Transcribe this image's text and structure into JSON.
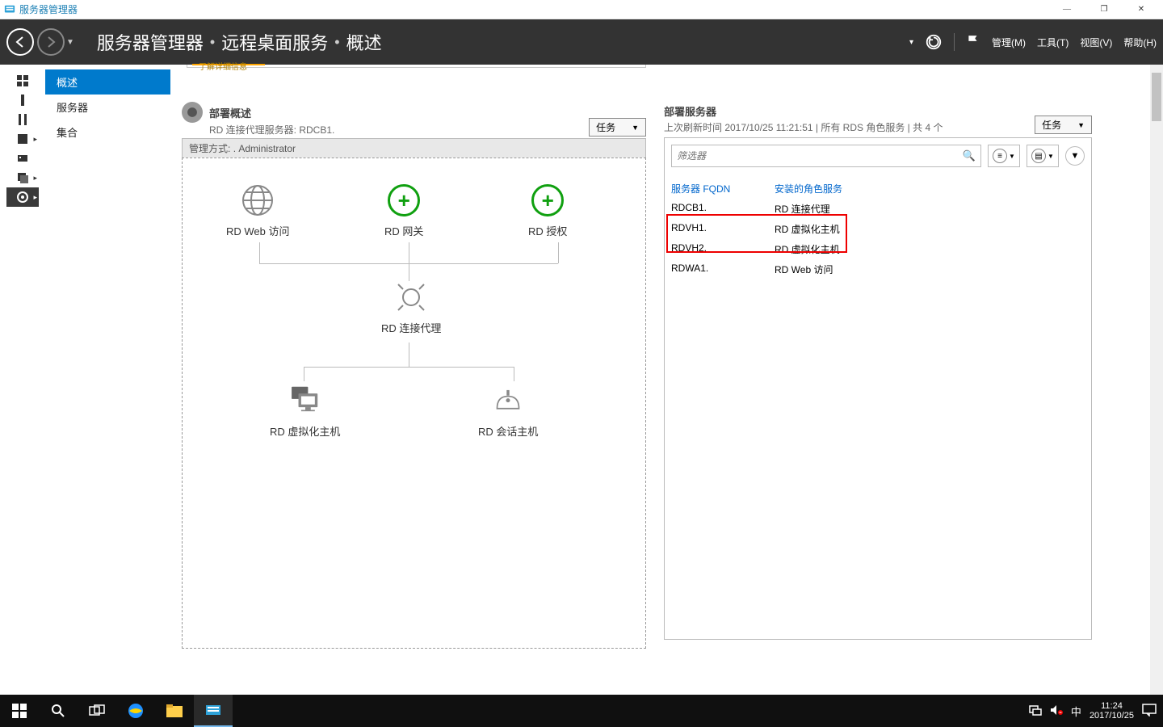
{
  "titlebar": {
    "app_name": "服务器管理器"
  },
  "header": {
    "breadcrumb": [
      "服务器管理器",
      "远程桌面服务",
      "概述"
    ],
    "menu": {
      "manage": "管理(M)",
      "tools": "工具(T)",
      "view": "视图(V)",
      "help": "帮助(H)"
    }
  },
  "iconstrip_icons": [
    "dashboard",
    "local",
    "all",
    "storage",
    "storage2",
    "roles",
    "rds"
  ],
  "sidebar": {
    "items": [
      "概述",
      "服务器",
      "集合"
    ],
    "active": 0
  },
  "notice": {
    "link": "了解详细信息"
  },
  "deployment": {
    "title": "部署概述",
    "subtitle_prefix": "RD 连接代理服务器: RDCB1.",
    "tasks": "任务",
    "mgmt_label": "管理方式:",
    "mgmt_value": ".           Administrator",
    "nodes": {
      "web": "RD Web 访问",
      "gateway": "RD 网关",
      "license": "RD 授权",
      "broker": "RD 连接代理",
      "virthost": "RD 虚拟化主机",
      "sessionhost": "RD 会话主机"
    }
  },
  "servers": {
    "title": "部署服务器",
    "subtitle": "上次刷新时间 2017/10/25 11:21:51 | 所有 RDS 角色服务  | 共 4 个",
    "tasks": "任务",
    "filter_placeholder": "筛选器",
    "columns": {
      "fqdn": "服务器 FQDN",
      "role": "安装的角色服务"
    },
    "rows": [
      {
        "fqdn": "RDCB1.",
        "role": "RD 连接代理"
      },
      {
        "fqdn": "RDVH1.",
        "role": "RD 虚拟化主机"
      },
      {
        "fqdn": "RDVH2.",
        "role": "RD 虚拟化主机"
      },
      {
        "fqdn": "RDWA1.",
        "role": "RD Web 访问"
      }
    ]
  },
  "taskbar": {
    "ime": "中",
    "time": "11:24",
    "date": "2017/10/25"
  }
}
